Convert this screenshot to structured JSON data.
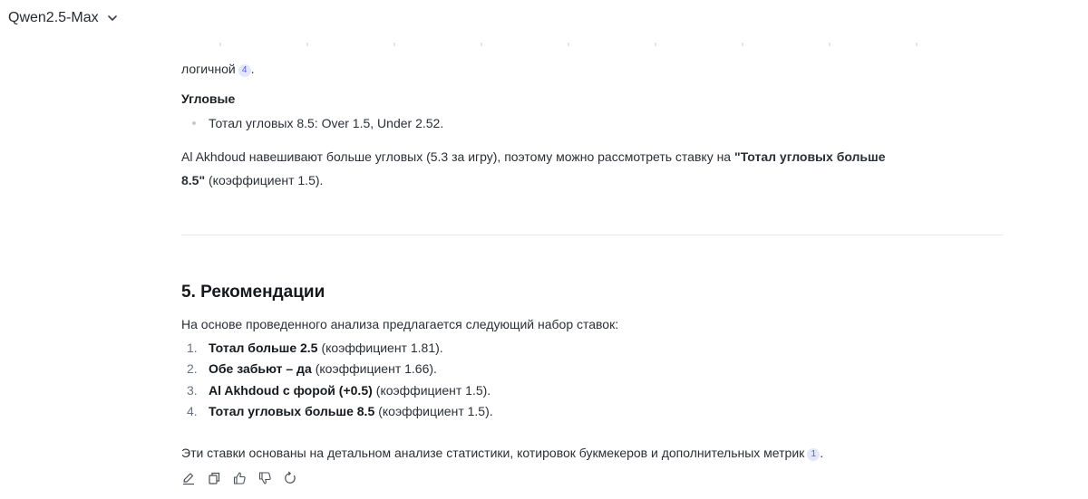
{
  "header": {
    "model_name": "Qwen2.5-Max"
  },
  "message": {
    "carry_text": "логичной",
    "carry_cite": "4",
    "carry_punct": ".",
    "corners": {
      "heading": "Угловые",
      "bullet": "Тотал угловых 8.5: Over 1.5, Under 2.52.",
      "paragraph_prefix": "Al Akhdoud навешивают больше угловых (5.3 за игру), поэтому можно рассмотреть ставку на ",
      "paragraph_bold_line1": "\"Тотал угловых больше",
      "paragraph_bold_line2": "8.5\"",
      "paragraph_suffix": " (коэффициент 1.5)."
    },
    "recommendations": {
      "title": "5. Рекомендации",
      "intro": "На основе проведенного анализа предлагается следующий набор ставок:",
      "items": [
        {
          "num": "1.",
          "bold": "Тотал больше 2.5",
          "rest": "(коэффициент 1.81)."
        },
        {
          "num": "2.",
          "bold": "Обе забьют – да",
          "rest": "(коэффициент 1.66)."
        },
        {
          "num": "3.",
          "bold": "Al Akhdoud с форой (+0.5)",
          "rest": "(коэффициент 1.5)."
        },
        {
          "num": "4.",
          "bold": "Тотал угловых больше 8.5",
          "rest": "(коэффициент 1.5)."
        }
      ],
      "conclusion": "Эти ставки основаны на детальном анализе статистики, котировок букмекеров и дополнительных метрик",
      "conclusion_cite": "1",
      "conclusion_punct": "."
    }
  },
  "actions": {
    "icons": [
      "edit-icon",
      "copy-icon",
      "thumbs-up-icon",
      "thumbs-down-icon",
      "regenerate-icon"
    ]
  },
  "colors": {
    "citation_bg": "#e4e6fb",
    "citation_fg": "#5a62d6"
  }
}
